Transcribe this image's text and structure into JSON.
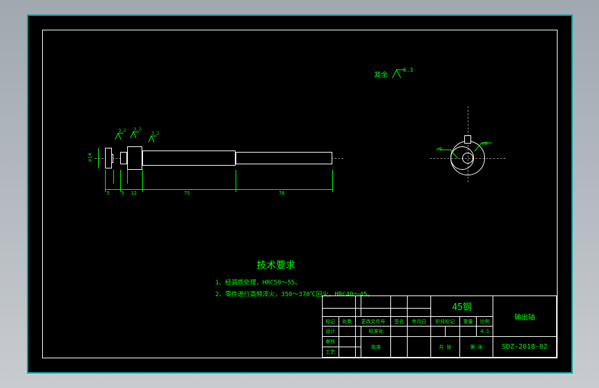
{
  "surface_finish": {
    "label": "其余",
    "value": "6.3"
  },
  "shaft": {
    "diameters_label_left": "⌀14",
    "surface_marks": [
      {
        "value": "3.2"
      },
      {
        "value": "3.2"
      },
      {
        "value": "3.2"
      }
    ],
    "lengths": {
      "seg1": "5",
      "seg2": "5",
      "seg3": "12",
      "seg4": "75",
      "seg5": "78"
    }
  },
  "endview": {
    "dim_left": "⌀6",
    "dim_right": "⌀8"
  },
  "tech_requirements": {
    "title": "技术要求",
    "line1": "1、经调质处理，HRC50～55。",
    "line2": "2、零件进行高频淬火，350～370℃回火，HRC40～45。"
  },
  "titleblock": {
    "material": "45钢",
    "part_name": "输出轴",
    "drawing_no": "SDZ-2018-02",
    "scale": "4:1",
    "headers": {
      "mark": "标记",
      "zone": "处数",
      "rev": "更改文件号",
      "sig": "签名",
      "date": "年月日",
      "design": "设计",
      "check": "审核",
      "process": "工艺",
      "approve": "批准",
      "stdcheck": "标准化",
      "weight": "重量",
      "scale_h": "比例",
      "stage": "阶段标记",
      "sheet": "共  张",
      "sheet2": "第  张"
    }
  }
}
